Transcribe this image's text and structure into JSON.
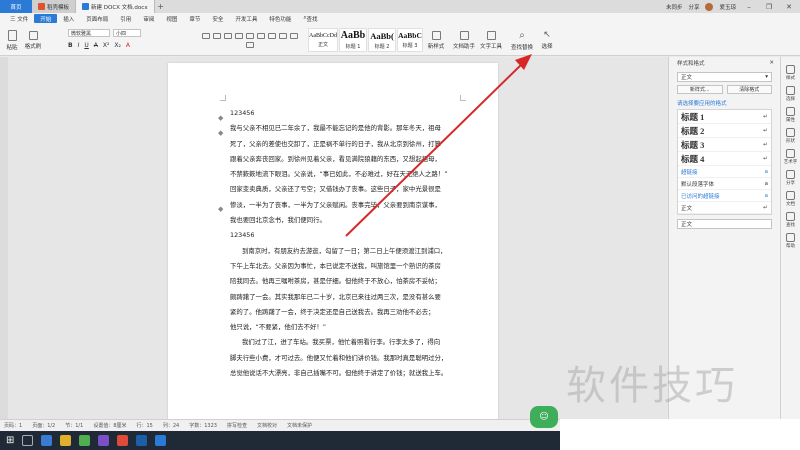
{
  "tabs": {
    "home": "首页",
    "templates": "稻壳模板",
    "document": "新建 DOCX 文档.docx",
    "add": "+"
  },
  "titlebar_right": {
    "login": "未同步",
    "share": "分享",
    "user": "爱玉琼"
  },
  "menu": {
    "file": "三 文件",
    "items": [
      "开始",
      "插入",
      "页面布局",
      "引用",
      "审阅",
      "视图",
      "章节",
      "安全",
      "开发工具",
      "特色功能",
      "查找"
    ],
    "active_index": 0
  },
  "ribbon": {
    "paste": "粘贴",
    "format_painter": "格式刷",
    "font": "微软雅黑",
    "size": "小四",
    "styles": [
      {
        "sample": "AaBbCcDd",
        "label": "正文"
      },
      {
        "sample": "AaBb",
        "label": "标题 1"
      },
      {
        "sample": "AaBb(",
        "label": "标题 2"
      },
      {
        "sample": "AaBbC",
        "label": "标题 3"
      }
    ],
    "new_style": "新样式",
    "writing_assistant": "文档助手",
    "text_tool": "文字工具",
    "find_replace": "查找替换",
    "select": "选择"
  },
  "document": {
    "lines": [
      "123456",
      "我与父亲不相见已二年余了，我最不能忘记的是他的背影。那年冬天，祖母",
      "死了，父亲的差使也交卸了，正是祸不单行的日子，我从北京到徐州，打算",
      "跟着父亲奔丧回家。到徐州见着父亲，看见满院狼藉的东西，又想起祖母，",
      "不禁簌簌地流下眼泪。父亲说，“事已如此，不必难过，好在天无绝人之路！”",
      "回家变卖典质，父亲还了亏空；又借钱办了丧事。这些日子，家中光景很是",
      "惨淡，一半为了丧事，一半为了父亲赋闲。丧事完毕，父亲要到南京谋事，",
      "我也要回北京念书，我们便同行。",
      "123456",
      "到南京时，有朋友约去游逛，勾留了一日；第二日上午便须渡江到浦口，",
      "下午上车北去。父亲因为事忙，本已说定不送我，叫旅馆里一个熟识的茶房",
      "陪我同去。他再三嘱咐茶房，甚是仔细。但他终于不放心，怕茶房不妥帖；",
      "颇踌躇了一会。其实我那年已二十岁，北京已来往过两三次，是没有甚么要",
      "紧的了。他踌躇了一会，终于决定还是自己送我去。我再三劝他不必去；",
      "他只说，“不要紧，他们去不好！”",
      "我们过了江，进了车站。我买票，他忙着照看行李。行李太多了，得向",
      "脚夫行些小费，才可过去。他便又忙着和他们讲价钱。我那时真是聪明过分，",
      "总觉他说话不大漂亮，非自己插嘴不可。但他终于讲定了价钱；就送我上车。"
    ]
  },
  "sidepanel": {
    "title": "样式和格式",
    "current_style": "正文",
    "new_style_btn": "新样式...",
    "clear_format_btn": "清除格式",
    "apply_hint": "请选择要应用的格式",
    "styles": [
      "标题 1",
      "标题 2",
      "标题 3",
      "标题 4"
    ],
    "extra": [
      "超链接",
      "默认段落字体",
      "已访问的超链接",
      "正文"
    ],
    "bottom_value": "正文"
  },
  "iconstrip": [
    "样式",
    "选择",
    "属性",
    "形状",
    "艺术字",
    "分享",
    "文档",
    "查找",
    "帮助"
  ],
  "statusbar": {
    "page": "页码：1",
    "pages": "页面：1/2",
    "section": "节：1/1",
    "setting": "设置值：8厘米",
    "row": "行：15",
    "col": "列：24",
    "words": "字数：1323",
    "spell": "拼写检查",
    "proof": "文档校对",
    "protect": "文档未保护"
  },
  "watermark": "软件技巧",
  "colors": {
    "accent": "#2b7bd6",
    "arrow": "#d62828",
    "float": "#3fae5a"
  }
}
